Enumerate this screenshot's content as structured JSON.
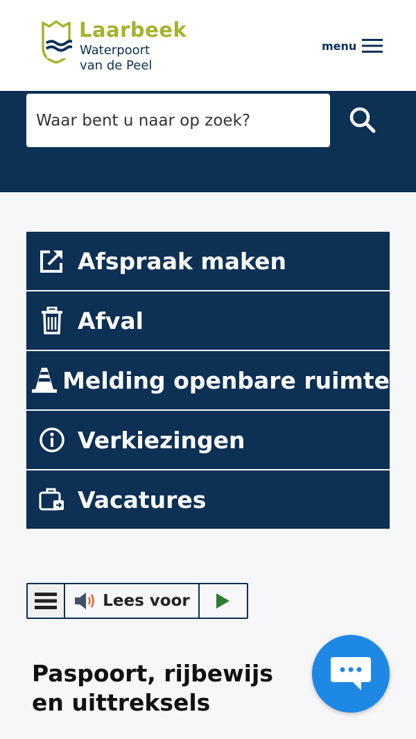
{
  "header": {
    "logo": {
      "name": "Laarbeek",
      "tagline_line1": "Waterpoort",
      "tagline_line2": "van de Peel"
    },
    "menu_label": "menu"
  },
  "search": {
    "placeholder": "Waar bent u naar op zoek?"
  },
  "quick_links": [
    {
      "label": "Afspraak maken",
      "icon": "external-link-icon"
    },
    {
      "label": "Afval",
      "icon": "trash-icon"
    },
    {
      "label": "Melding openbare ruimte",
      "icon": "traffic-cone-icon"
    },
    {
      "label": "Verkiezingen",
      "icon": "info-icon"
    },
    {
      "label": "Vacatures",
      "icon": "briefcase-icon"
    }
  ],
  "tts": {
    "read_label": "Lees voor"
  },
  "section": {
    "title": "Paspoort, rijbewijs en uittreksels"
  },
  "colors": {
    "navy": "#0d3055",
    "brand_green": "#a3b42d",
    "chat_blue": "#1e88e5",
    "play_green": "#2e7d32"
  }
}
